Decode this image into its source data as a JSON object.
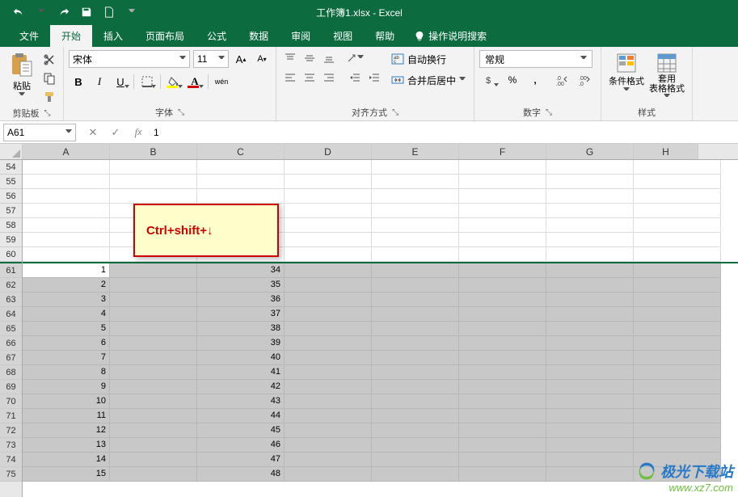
{
  "titlebar": {
    "title": "工作簿1.xlsx - Excel"
  },
  "tabs": [
    "文件",
    "开始",
    "插入",
    "页面布局",
    "公式",
    "数据",
    "审阅",
    "视图",
    "帮助"
  ],
  "active_tab": 1,
  "tell_me": "操作说明搜索",
  "ribbon": {
    "clipboard": {
      "paste": "粘贴",
      "label": "剪贴板"
    },
    "font": {
      "name": "宋体",
      "size": "11",
      "bold": "B",
      "italic": "I",
      "underline": "U",
      "ruby": "wén",
      "fill_color": "#ffff00",
      "font_color": "#d00000",
      "label": "字体"
    },
    "alignment": {
      "wrap": "自动换行",
      "merge": "合并后居中",
      "label": "对齐方式"
    },
    "number": {
      "format": "常规",
      "label": "数字"
    },
    "styles": {
      "cond": "条件格式",
      "table": "套用\n表格格式",
      "label": "样式"
    }
  },
  "name_box": "A61",
  "formula_value": "1",
  "columns": [
    "A",
    "B",
    "C",
    "D",
    "E",
    "F",
    "G",
    "H"
  ],
  "top_rows": [
    54,
    55,
    56,
    57,
    58,
    59,
    60
  ],
  "data_rows": [
    {
      "r": 61,
      "a": "1",
      "c": "34"
    },
    {
      "r": 62,
      "a": "2",
      "c": "35"
    },
    {
      "r": 63,
      "a": "3",
      "c": "36"
    },
    {
      "r": 64,
      "a": "4",
      "c": "37"
    },
    {
      "r": 65,
      "a": "5",
      "c": "38"
    },
    {
      "r": 66,
      "a": "6",
      "c": "39"
    },
    {
      "r": 67,
      "a": "7",
      "c": "40"
    },
    {
      "r": 68,
      "a": "8",
      "c": "41"
    },
    {
      "r": 69,
      "a": "9",
      "c": "42"
    },
    {
      "r": 70,
      "a": "10",
      "c": "43"
    },
    {
      "r": 71,
      "a": "11",
      "c": "44"
    },
    {
      "r": 72,
      "a": "12",
      "c": "45"
    },
    {
      "r": 73,
      "a": "13",
      "c": "46"
    },
    {
      "r": 74,
      "a": "14",
      "c": "47"
    },
    {
      "r": 75,
      "a": "15",
      "c": "48"
    }
  ],
  "active_cell": "A61",
  "callout_text": "Ctrl+shift+↓",
  "watermark": {
    "brand": "极光下载站",
    "url": "www.xz7.com"
  }
}
